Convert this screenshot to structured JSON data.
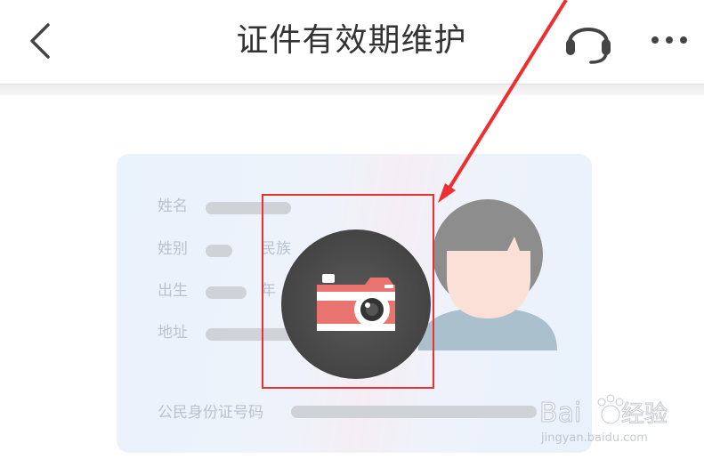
{
  "header": {
    "title": "证件有效期维护",
    "back_icon": "chevron-left-icon",
    "service_icon": "headset-icon",
    "more_icon": "more-dots-icon"
  },
  "id_card": {
    "labels": {
      "name": "姓名",
      "gender": "姓别",
      "ethnicity": "民族",
      "birth": "出生",
      "year": "年",
      "address": "地址",
      "id_number": "公民身份证号码"
    },
    "avatar_icon": "person-avatar-icon",
    "camera_icon": "camera-icon"
  },
  "watermark": {
    "brand": "Bai",
    "brand_suffix": "经验",
    "url": "jingyan.baidu.com"
  },
  "colors": {
    "highlight": "#ee2f2f",
    "card_bg": "#eaf2fb",
    "camera_red": "#e8736f"
  }
}
